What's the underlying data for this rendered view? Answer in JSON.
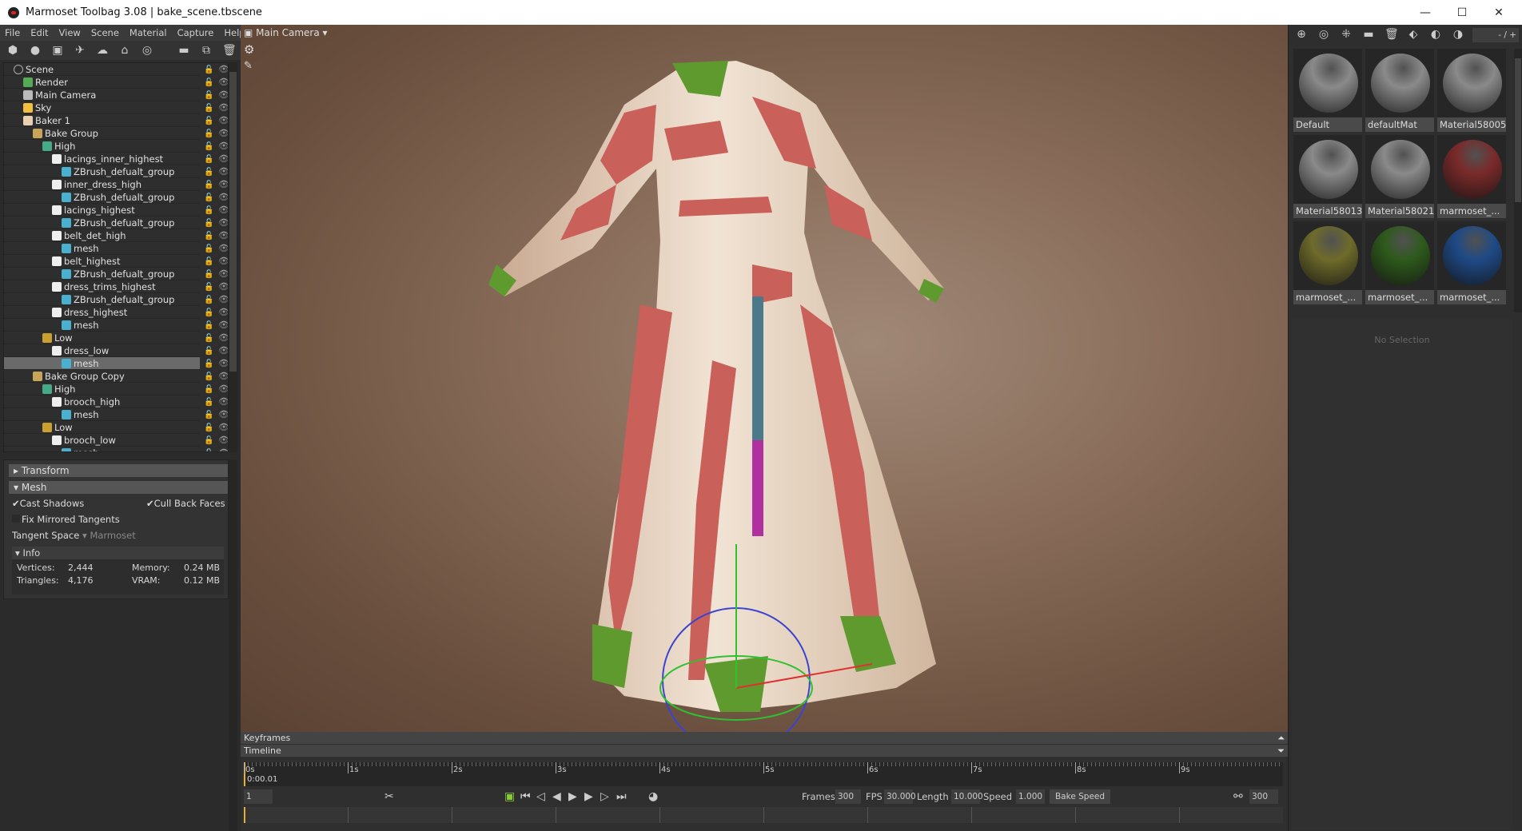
{
  "window": {
    "title": "Marmoset Toolbag 3.08  |  bake_scene.tbscene",
    "minimize": "—",
    "maximize": "☐",
    "close": "✕"
  },
  "menu": [
    "File",
    "Edit",
    "View",
    "Scene",
    "Material",
    "Capture",
    "Help"
  ],
  "toolbar_icons": [
    "mesh-icon",
    "light-icon",
    "camera-icon",
    "shadow-catcher-icon",
    "fog-icon",
    "baker-icon",
    "turntable-icon",
    "folder-icon",
    "duplicate-icon",
    "delete-icon"
  ],
  "tree": [
    {
      "label": "Scene",
      "depth": 0,
      "icon": "scene"
    },
    {
      "label": "Render",
      "depth": 1,
      "icon": "render"
    },
    {
      "label": "Main Camera",
      "depth": 1,
      "icon": "camera"
    },
    {
      "label": "Sky",
      "depth": 1,
      "icon": "sky"
    },
    {
      "label": "Baker 1",
      "depth": 1,
      "icon": "baker"
    },
    {
      "label": "Bake Group",
      "depth": 2,
      "icon": "folder"
    },
    {
      "label": "High",
      "depth": 3,
      "icon": "high"
    },
    {
      "label": "lacings_inner_highest",
      "depth": 4,
      "icon": "object"
    },
    {
      "label": "ZBrush_defualt_group",
      "depth": 5,
      "icon": "mesh"
    },
    {
      "label": "inner_dress_high",
      "depth": 4,
      "icon": "object"
    },
    {
      "label": "ZBrush_defualt_group",
      "depth": 5,
      "icon": "mesh"
    },
    {
      "label": "lacings_highest",
      "depth": 4,
      "icon": "object"
    },
    {
      "label": "ZBrush_defualt_group",
      "depth": 5,
      "icon": "mesh"
    },
    {
      "label": "belt_det_high",
      "depth": 4,
      "icon": "object"
    },
    {
      "label": "mesh",
      "depth": 5,
      "icon": "mesh"
    },
    {
      "label": "belt_highest",
      "depth": 4,
      "icon": "object"
    },
    {
      "label": "ZBrush_defualt_group",
      "depth": 5,
      "icon": "mesh"
    },
    {
      "label": "dress_trims_highest",
      "depth": 4,
      "icon": "object"
    },
    {
      "label": "ZBrush_defualt_group",
      "depth": 5,
      "icon": "mesh"
    },
    {
      "label": "dress_highest",
      "depth": 4,
      "icon": "object"
    },
    {
      "label": "mesh",
      "depth": 5,
      "icon": "mesh"
    },
    {
      "label": "Low",
      "depth": 3,
      "icon": "low"
    },
    {
      "label": "dress_low",
      "depth": 4,
      "icon": "object"
    },
    {
      "label": "mesh",
      "depth": 5,
      "icon": "mesh",
      "selected": true
    },
    {
      "label": "Bake Group Copy",
      "depth": 2,
      "icon": "folder"
    },
    {
      "label": "High",
      "depth": 3,
      "icon": "high"
    },
    {
      "label": "brooch_high",
      "depth": 4,
      "icon": "object"
    },
    {
      "label": "mesh",
      "depth": 5,
      "icon": "mesh"
    },
    {
      "label": "Low",
      "depth": 3,
      "icon": "low"
    },
    {
      "label": "brooch_low",
      "depth": 4,
      "icon": "object"
    },
    {
      "label": "mesh",
      "depth": 5,
      "icon": "mesh"
    }
  ],
  "properties": {
    "transform": "Transform",
    "mesh": "Mesh",
    "cast_shadows": {
      "label": "Cast Shadows",
      "checked": true
    },
    "cull_back_faces": {
      "label": "Cull Back Faces",
      "checked": true
    },
    "fix_mirrored": {
      "label": "Fix Mirrored Tangents",
      "checked": false
    },
    "tangent_space_label": "Tangent Space",
    "tangent_space_value": "Marmoset",
    "info": "Info",
    "vertices_label": "Vertices:",
    "vertices": "2,444",
    "triangles_label": "Triangles:",
    "triangles": "4,176",
    "memory_label": "Memory:",
    "memory": "0.24 MB",
    "vram_label": "VRAM:",
    "vram": "0.12 MB"
  },
  "viewport": {
    "camera": "Main Camera"
  },
  "materials": {
    "counter": "- / +",
    "items": [
      {
        "name": "Default",
        "color": "#8a8a8a"
      },
      {
        "name": "defaultMat",
        "color": "#8a8a8a"
      },
      {
        "name": "Material58005",
        "color": "#8a8a8a"
      },
      {
        "name": "Material58013",
        "color": "#8a8a8a"
      },
      {
        "name": "Material58021",
        "color": "#8a8a8a"
      },
      {
        "name": "marmoset_...",
        "color": "#7a2a2a"
      },
      {
        "name": "marmoset_...",
        "color": "#6e6b2a"
      },
      {
        "name": "marmoset_...",
        "color": "#2e5a1c"
      },
      {
        "name": "marmoset_...",
        "color": "#1f4a86"
      }
    ],
    "no_selection": "No Selection"
  },
  "timeline": {
    "keyframes": "Keyframes",
    "timeline": "Timeline",
    "ticks": [
      "0s",
      "1s",
      "2s",
      "3s",
      "4s",
      "5s",
      "6s",
      "7s",
      "8s",
      "9s"
    ],
    "current_time": "0:00.01",
    "frame": "1",
    "frames_label": "Frames",
    "frames": "300",
    "fps_label": "FPS",
    "fps": "30.000",
    "length_label": "Length",
    "length": "10.000",
    "speed_label": "Speed",
    "speed": "1.000",
    "bake_speed": "Bake Speed",
    "end_frame": "300"
  }
}
